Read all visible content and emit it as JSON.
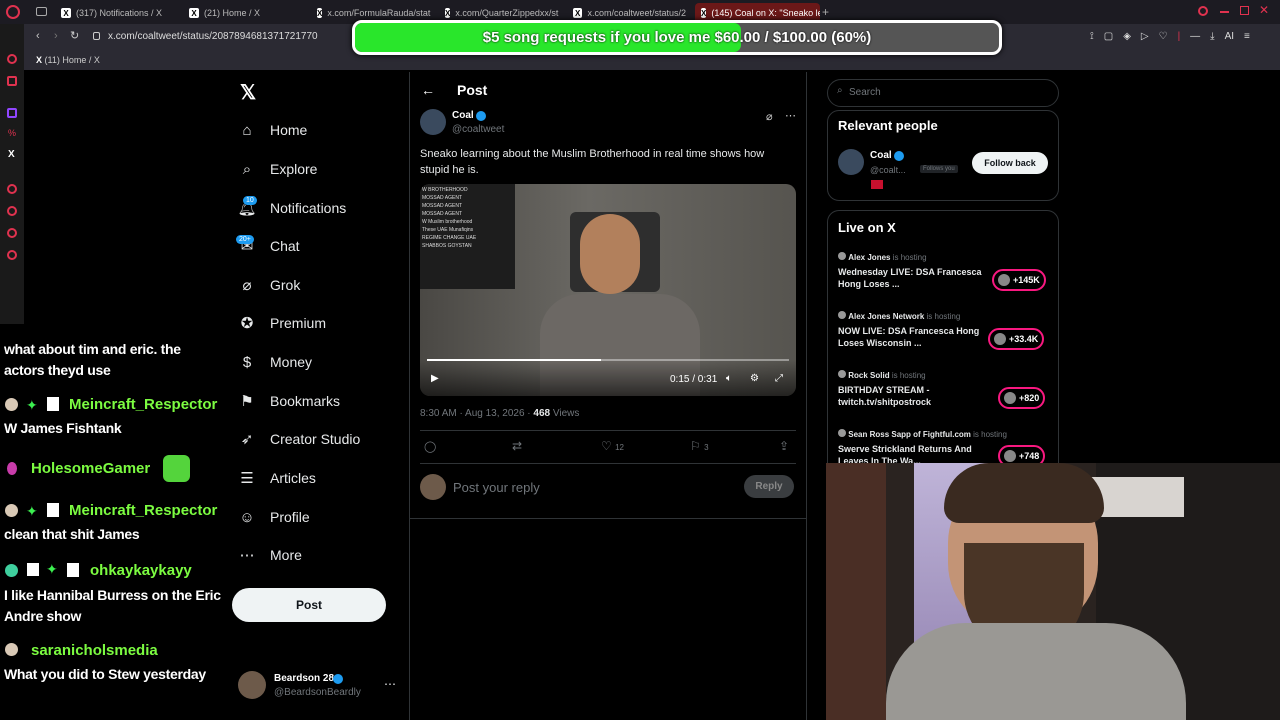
{
  "browser": {
    "tabs": [
      "(317) Notifications / X",
      "(21) Home / X",
      "x.com/FormulaRauda/stat",
      "x.com/QuarterZippedxx/st",
      "x.com/coaltweet/status/2",
      "(145) Coal on X: \"Sneako le"
    ],
    "url": "x.com/coaltweet/status/2087894681371721770",
    "bookmark": "(11) Home / X",
    "ai_label": "AI"
  },
  "donation": {
    "text": "$5 song requests if you love me $60.00 / $100.00 (60%)",
    "progress": 0.6
  },
  "nav": {
    "items": [
      {
        "label": "Home",
        "icon": "home-icon"
      },
      {
        "label": "Explore",
        "icon": "search-icon"
      },
      {
        "label": "Notifications",
        "icon": "bell-icon",
        "badge": "10"
      },
      {
        "label": "Chat",
        "icon": "chat-icon",
        "badge": "20+"
      },
      {
        "label": "Grok",
        "icon": "grok-icon"
      },
      {
        "label": "Premium",
        "icon": "premium-icon"
      },
      {
        "label": "Money",
        "icon": "money-icon"
      },
      {
        "label": "Bookmarks",
        "icon": "bookmark-icon"
      },
      {
        "label": "Creator Studio",
        "icon": "rocket-icon"
      },
      {
        "label": "Articles",
        "icon": "article-icon"
      },
      {
        "label": "Profile",
        "icon": "profile-icon"
      },
      {
        "label": "More",
        "icon": "more-icon"
      }
    ],
    "post_label": "Post",
    "account": {
      "name": "Beardson 28",
      "handle": "@BeardsonBeardly"
    }
  },
  "post": {
    "header": "Post",
    "author": "Coal",
    "handle": "@coaltweet",
    "text": "Sneako learning about the Muslim Brotherhood in real time shows how stupid he is.",
    "video_time": "0:15 / 0:31",
    "video_progress": 0.48,
    "timestamp": "8:30 AM · Aug 13, 2026 ·",
    "views_count": "468",
    "views_label": "Views",
    "likes": "12",
    "bookmarks": "3",
    "reply_placeholder": "Post your reply",
    "reply_button": "Reply",
    "video_chat_lines": [
      "W BROTHERHOOD",
      "MOSSAD AGENT",
      "MOSSAD AGENT",
      "MOSSAD AGENT",
      "W Muslim brotherhood",
      "These UAE Munafiqins",
      "REGIME CHANGE UAE",
      "SHABBOS GOYSTAN"
    ]
  },
  "right": {
    "search_placeholder": "Search",
    "relevant_title": "Relevant people",
    "relevant": {
      "name": "Coal",
      "handle": "@coalt...",
      "follows_you": "Follows you",
      "button": "Follow back"
    },
    "live_title": "Live on X",
    "live": [
      {
        "host": "Alex Jones",
        "status": "is hosting",
        "title": "Wednesday LIVE: DSA Francesca Hong Loses ...",
        "count": "+145K"
      },
      {
        "host": "Alex Jones Network",
        "status": "is hosting",
        "title": "NOW LIVE: DSA Francesca Hong Loses Wisconsin ...",
        "count": "+33.4K"
      },
      {
        "host": "Rock Solid",
        "status": "is hosting",
        "title": "BIRTHDAY STREAM - twitch.tv/shitpostrock",
        "count": "+820"
      },
      {
        "host": "Sean Ross Sapp of Fightful.com",
        "status": "is hosting",
        "title": "Swerve Strickland Returns And Leaves In The Wa...",
        "count": "+748"
      }
    ]
  },
  "chat": [
    {
      "user": "",
      "text": "what about tim and eric. the actors theyd use"
    },
    {
      "user": "Meincraft_Respector",
      "text": "W James Fishtank"
    },
    {
      "user": "HolesomeGamer",
      "text": ""
    },
    {
      "user": "Meincraft_Respector",
      "text": "clean that shit James"
    },
    {
      "user": "ohkaykaykayy",
      "text": "I like Hannibal Burress on the Eric Andre show"
    },
    {
      "user": "saranicholsmedia",
      "text": "What you did to Stew yesterday"
    }
  ]
}
